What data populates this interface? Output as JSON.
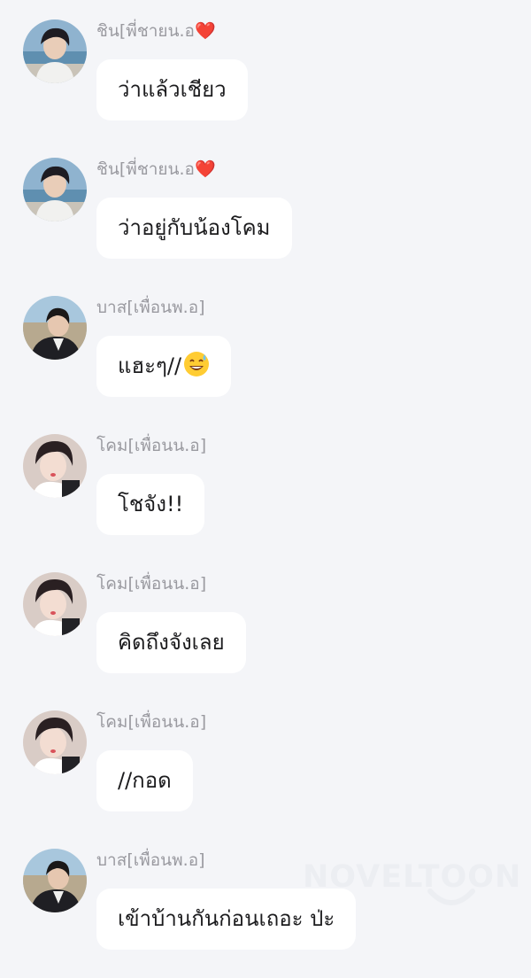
{
  "messages": [
    {
      "sender": "ชิน[พี่ชายน.อ",
      "sender_suffix": "❤️",
      "text": "ว่าแล้วเชียว",
      "avatar": "avatar-shin"
    },
    {
      "sender": "ชิน[พี่ชายน.อ",
      "sender_suffix": "❤️",
      "text": "ว่าอยู่กับน้องโคม",
      "avatar": "avatar-shin"
    },
    {
      "sender": "บาส[เพื่อนพ.อ]",
      "text": "แฮะๆ//",
      "emoji": "grinning-sweat-emoji",
      "avatar": "avatar-bas"
    },
    {
      "sender": "โคม[เพื่อนน.อ]",
      "text": "โชจัง!!",
      "avatar": "avatar-khom"
    },
    {
      "sender": "โคม[เพื่อนน.อ]",
      "text": "คิดถึงจังเลย",
      "avatar": "avatar-khom"
    },
    {
      "sender": "โคม[เพื่อนน.อ]",
      "text": "//กอด",
      "avatar": "avatar-khom"
    },
    {
      "sender": "บาส[เพื่อนพ.อ]",
      "text": "เข้าบ้านกันก่อนเถอะ ป่ะ",
      "avatar": "avatar-bas"
    }
  ],
  "watermark": "NOVELTOON",
  "colors": {
    "background": "#f4f5f8",
    "bubble": "#ffffff",
    "sender_name": "#9a9aa0",
    "message_text": "#1c1c1e",
    "heart": "#f28b8b"
  }
}
